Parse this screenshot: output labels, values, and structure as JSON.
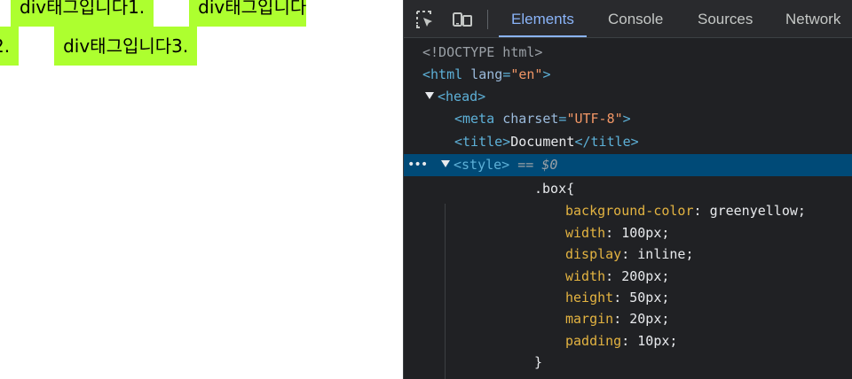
{
  "viewport": {
    "boxes": [
      {
        "text": "div태그입니다1."
      },
      {
        "text": "div태그입니다2."
      },
      {
        "text": "div태그입니다3."
      }
    ],
    "box_color": "#adff2f"
  },
  "devtools": {
    "tabs": [
      {
        "label": "Elements",
        "active": true
      },
      {
        "label": "Console"
      },
      {
        "label": "Sources"
      },
      {
        "label": "Network"
      }
    ],
    "icons": [
      "inspect-element-icon",
      "device-toolbar-icon"
    ],
    "selected_suffix": "== $0",
    "code": {
      "doctype": "<!DOCTYPE html>",
      "html_open": "<html",
      "html_attr": "lang",
      "html_attr_val": "\"en\"",
      "html_close": ">",
      "head": "<head>",
      "meta_open": "<meta",
      "meta_attr": "charset",
      "meta_attr_val": "\"UTF-8\"",
      "meta_close": ">",
      "title_open": "<title>",
      "title_text": "Document",
      "title_close": "</title>",
      "style_tag": "<style>",
      "selector": ".box{",
      "props": [
        {
          "name": "background-color",
          "value": "greenyellow;"
        },
        {
          "name": "width",
          "value": "100px;"
        },
        {
          "name": "display",
          "value": "inline;"
        },
        {
          "name": "width",
          "value": "200px;"
        },
        {
          "name": "height",
          "value": "50px;"
        },
        {
          "name": "margin",
          "value": "20px;"
        },
        {
          "name": "padding",
          "value": "10px;"
        }
      ],
      "closing_brace": "}"
    }
  },
  "colors": {
    "devtools_bg": "#202124",
    "selected_row": "#004a77",
    "active_tab": "#8ab4f8",
    "tag": "#5db0d7",
    "property": "#e3b341"
  }
}
